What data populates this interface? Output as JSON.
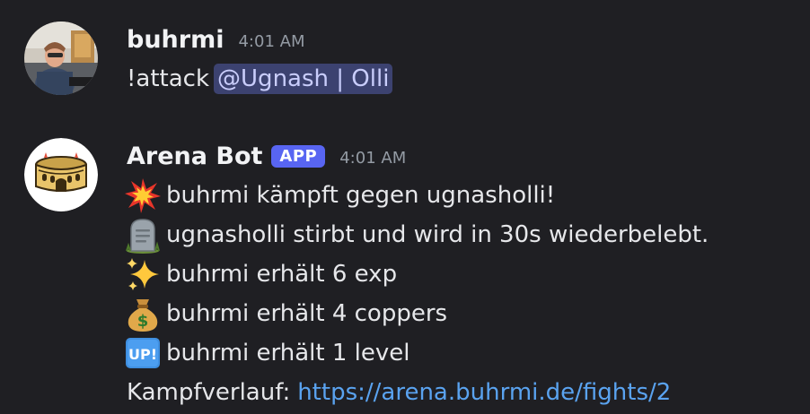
{
  "messages": [
    {
      "author": "buhrmi",
      "timestamp": "4:01 AM",
      "command": "!attack",
      "mention": "@Ugnash | Olli"
    },
    {
      "author": "Arena Bot",
      "badge": "APP",
      "timestamp": "4:01 AM",
      "lines": [
        {
          "icon": "collision-icon",
          "text": "buhrmi kämpft gegen ugnasholli!"
        },
        {
          "icon": "headstone-icon",
          "text": "ugnasholli stirbt und wird in 30s wiederbelebt."
        },
        {
          "icon": "sparkles-icon",
          "text": "buhrmi erhält 6 exp"
        },
        {
          "icon": "money-bag-icon",
          "text": "buhrmi erhält 4 coppers"
        },
        {
          "icon": "up-button-icon",
          "text": "buhrmi erhält 1 level"
        }
      ],
      "link_label": "Kampfverlauf:",
      "link_url": "https://arena.buhrmi.de/fights/2"
    }
  ],
  "colors": {
    "background": "#1f1f23",
    "mention_bg": "#3c4270",
    "mention_text": "#c9cdfb",
    "badge": "#5865f2",
    "link": "#5aa3f0",
    "timestamp": "#949ba4"
  }
}
